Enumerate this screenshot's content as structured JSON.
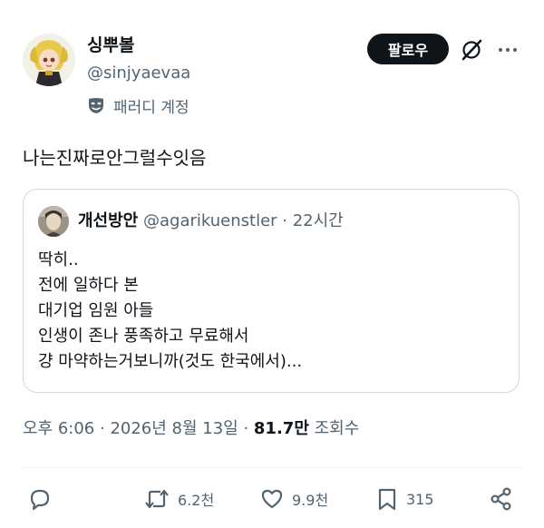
{
  "author": {
    "display_name": "싱뿌볼",
    "handle": "@sinjyaevaa",
    "account_label": "패러디 계정",
    "avatar_icon": "figurine-avatar"
  },
  "header": {
    "follow_label": "팔로우",
    "grok_icon": "grok-slash-icon",
    "more_icon": "more-dots-icon"
  },
  "tweet": {
    "text": "나는진짜로안그럴수잇음"
  },
  "quoted_tweet": {
    "display_name": "개선방안",
    "handle": "@agarikuenstler",
    "separator": " · ",
    "time": "22시간",
    "lines": [
      "딱히..",
      "전에 일하다 본",
      "대기업 임원 아들",
      "인생이 존나 풍족하고 무료해서",
      "걍 마약하는거보니까(것도 한국에서)..."
    ]
  },
  "meta": {
    "time": "오후 6:06",
    "separator": " · ",
    "date": "2026년 8월 13일",
    "views": "81.7만",
    "views_label": " 조회수"
  },
  "actions": {
    "reply_icon": "reply-icon",
    "retweet_count": "6.2천",
    "like_count": "9.9천",
    "bookmark_count": "315",
    "share_icon": "share-icon"
  },
  "colors": {
    "text": "#0f1419",
    "secondary": "#536471",
    "border": "#cfd9de",
    "follow_bg": "#0f1419"
  }
}
